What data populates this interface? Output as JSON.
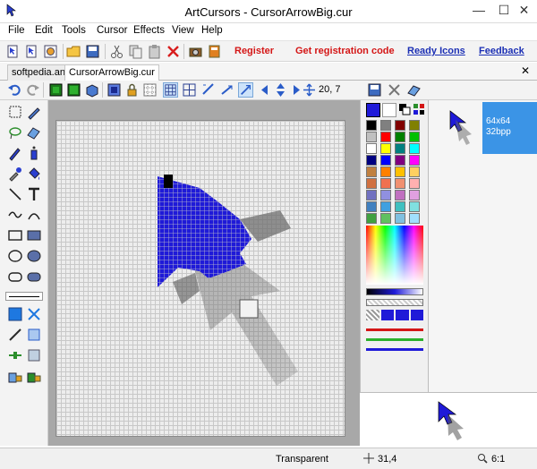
{
  "window": {
    "title": "ArtCursors - CursorArrowBig.cur",
    "minimize": "—",
    "maximize": "☐",
    "close": "✕"
  },
  "menu": [
    "File",
    "Edit",
    "Tools",
    "Cursor",
    "Effects",
    "View",
    "Help"
  ],
  "links": {
    "register": "Register",
    "get_code": "Get registration code",
    "ready_icons": "Ready Icons",
    "feedback": "Feedback"
  },
  "tabs": [
    {
      "label": "softpedia.ani",
      "active": false
    },
    {
      "label": "CursorArrowBig.cur",
      "active": true
    }
  ],
  "tab_close": "✕",
  "toolbar2": {
    "coords": "20, 7"
  },
  "preview": {
    "size": "64x64",
    "depth": "32bpp"
  },
  "status": {
    "transparent": "Transparent",
    "position": "31,4",
    "zoom": "6:1"
  },
  "colors": {
    "accent": "#1f1ad8",
    "selection": "#3b94e6",
    "palette": [
      "#000000",
      "#808080",
      "#800000",
      "#808000",
      "#c0c0c0",
      "#ff0000",
      "#008000",
      "#00c000",
      "#ffffff",
      "#ffff00",
      "#008080",
      "#00ffff",
      "#000080",
      "#0000ff",
      "#800080",
      "#ff00ff",
      "#c08040",
      "#ff8000",
      "#ffc000",
      "#ffd060",
      "#d07040",
      "#f07050",
      "#f09070",
      "#ffb0b0",
      "#7070c0",
      "#9090e0",
      "#c070c0",
      "#e0a0e0",
      "#4080c0",
      "#40a0e0",
      "#40c0c0",
      "#80e0e0",
      "#40a040",
      "#60c060",
      "#80c0e0",
      "#a0e0ff"
    ]
  }
}
